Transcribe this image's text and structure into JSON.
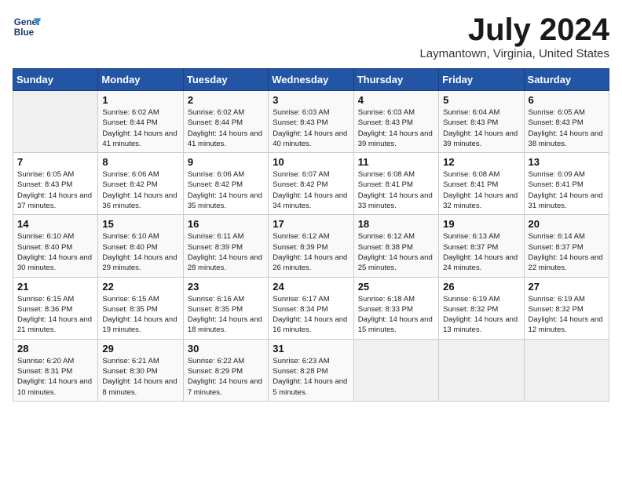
{
  "header": {
    "logo_line1": "General",
    "logo_line2": "Blue",
    "month_year": "July 2024",
    "location": "Laymantown, Virginia, United States"
  },
  "weekdays": [
    "Sunday",
    "Monday",
    "Tuesday",
    "Wednesday",
    "Thursday",
    "Friday",
    "Saturday"
  ],
  "weeks": [
    [
      {
        "day": "",
        "sunrise": "",
        "sunset": "",
        "daylight": ""
      },
      {
        "day": "1",
        "sunrise": "Sunrise: 6:02 AM",
        "sunset": "Sunset: 8:44 PM",
        "daylight": "Daylight: 14 hours and 41 minutes."
      },
      {
        "day": "2",
        "sunrise": "Sunrise: 6:02 AM",
        "sunset": "Sunset: 8:44 PM",
        "daylight": "Daylight: 14 hours and 41 minutes."
      },
      {
        "day": "3",
        "sunrise": "Sunrise: 6:03 AM",
        "sunset": "Sunset: 8:43 PM",
        "daylight": "Daylight: 14 hours and 40 minutes."
      },
      {
        "day": "4",
        "sunrise": "Sunrise: 6:03 AM",
        "sunset": "Sunset: 8:43 PM",
        "daylight": "Daylight: 14 hours and 39 minutes."
      },
      {
        "day": "5",
        "sunrise": "Sunrise: 6:04 AM",
        "sunset": "Sunset: 8:43 PM",
        "daylight": "Daylight: 14 hours and 39 minutes."
      },
      {
        "day": "6",
        "sunrise": "Sunrise: 6:05 AM",
        "sunset": "Sunset: 8:43 PM",
        "daylight": "Daylight: 14 hours and 38 minutes."
      }
    ],
    [
      {
        "day": "7",
        "sunrise": "Sunrise: 6:05 AM",
        "sunset": "Sunset: 8:43 PM",
        "daylight": "Daylight: 14 hours and 37 minutes."
      },
      {
        "day": "8",
        "sunrise": "Sunrise: 6:06 AM",
        "sunset": "Sunset: 8:42 PM",
        "daylight": "Daylight: 14 hours and 36 minutes."
      },
      {
        "day": "9",
        "sunrise": "Sunrise: 6:06 AM",
        "sunset": "Sunset: 8:42 PM",
        "daylight": "Daylight: 14 hours and 35 minutes."
      },
      {
        "day": "10",
        "sunrise": "Sunrise: 6:07 AM",
        "sunset": "Sunset: 8:42 PM",
        "daylight": "Daylight: 14 hours and 34 minutes."
      },
      {
        "day": "11",
        "sunrise": "Sunrise: 6:08 AM",
        "sunset": "Sunset: 8:41 PM",
        "daylight": "Daylight: 14 hours and 33 minutes."
      },
      {
        "day": "12",
        "sunrise": "Sunrise: 6:08 AM",
        "sunset": "Sunset: 8:41 PM",
        "daylight": "Daylight: 14 hours and 32 minutes."
      },
      {
        "day": "13",
        "sunrise": "Sunrise: 6:09 AM",
        "sunset": "Sunset: 8:41 PM",
        "daylight": "Daylight: 14 hours and 31 minutes."
      }
    ],
    [
      {
        "day": "14",
        "sunrise": "Sunrise: 6:10 AM",
        "sunset": "Sunset: 8:40 PM",
        "daylight": "Daylight: 14 hours and 30 minutes."
      },
      {
        "day": "15",
        "sunrise": "Sunrise: 6:10 AM",
        "sunset": "Sunset: 8:40 PM",
        "daylight": "Daylight: 14 hours and 29 minutes."
      },
      {
        "day": "16",
        "sunrise": "Sunrise: 6:11 AM",
        "sunset": "Sunset: 8:39 PM",
        "daylight": "Daylight: 14 hours and 28 minutes."
      },
      {
        "day": "17",
        "sunrise": "Sunrise: 6:12 AM",
        "sunset": "Sunset: 8:39 PM",
        "daylight": "Daylight: 14 hours and 26 minutes."
      },
      {
        "day": "18",
        "sunrise": "Sunrise: 6:12 AM",
        "sunset": "Sunset: 8:38 PM",
        "daylight": "Daylight: 14 hours and 25 minutes."
      },
      {
        "day": "19",
        "sunrise": "Sunrise: 6:13 AM",
        "sunset": "Sunset: 8:37 PM",
        "daylight": "Daylight: 14 hours and 24 minutes."
      },
      {
        "day": "20",
        "sunrise": "Sunrise: 6:14 AM",
        "sunset": "Sunset: 8:37 PM",
        "daylight": "Daylight: 14 hours and 22 minutes."
      }
    ],
    [
      {
        "day": "21",
        "sunrise": "Sunrise: 6:15 AM",
        "sunset": "Sunset: 8:36 PM",
        "daylight": "Daylight: 14 hours and 21 minutes."
      },
      {
        "day": "22",
        "sunrise": "Sunrise: 6:15 AM",
        "sunset": "Sunset: 8:35 PM",
        "daylight": "Daylight: 14 hours and 19 minutes."
      },
      {
        "day": "23",
        "sunrise": "Sunrise: 6:16 AM",
        "sunset": "Sunset: 8:35 PM",
        "daylight": "Daylight: 14 hours and 18 minutes."
      },
      {
        "day": "24",
        "sunrise": "Sunrise: 6:17 AM",
        "sunset": "Sunset: 8:34 PM",
        "daylight": "Daylight: 14 hours and 16 minutes."
      },
      {
        "day": "25",
        "sunrise": "Sunrise: 6:18 AM",
        "sunset": "Sunset: 8:33 PM",
        "daylight": "Daylight: 14 hours and 15 minutes."
      },
      {
        "day": "26",
        "sunrise": "Sunrise: 6:19 AM",
        "sunset": "Sunset: 8:32 PM",
        "daylight": "Daylight: 14 hours and 13 minutes."
      },
      {
        "day": "27",
        "sunrise": "Sunrise: 6:19 AM",
        "sunset": "Sunset: 8:32 PM",
        "daylight": "Daylight: 14 hours and 12 minutes."
      }
    ],
    [
      {
        "day": "28",
        "sunrise": "Sunrise: 6:20 AM",
        "sunset": "Sunset: 8:31 PM",
        "daylight": "Daylight: 14 hours and 10 minutes."
      },
      {
        "day": "29",
        "sunrise": "Sunrise: 6:21 AM",
        "sunset": "Sunset: 8:30 PM",
        "daylight": "Daylight: 14 hours and 8 minutes."
      },
      {
        "day": "30",
        "sunrise": "Sunrise: 6:22 AM",
        "sunset": "Sunset: 8:29 PM",
        "daylight": "Daylight: 14 hours and 7 minutes."
      },
      {
        "day": "31",
        "sunrise": "Sunrise: 6:23 AM",
        "sunset": "Sunset: 8:28 PM",
        "daylight": "Daylight: 14 hours and 5 minutes."
      },
      {
        "day": "",
        "sunrise": "",
        "sunset": "",
        "daylight": ""
      },
      {
        "day": "",
        "sunrise": "",
        "sunset": "",
        "daylight": ""
      },
      {
        "day": "",
        "sunrise": "",
        "sunset": "",
        "daylight": ""
      }
    ]
  ]
}
